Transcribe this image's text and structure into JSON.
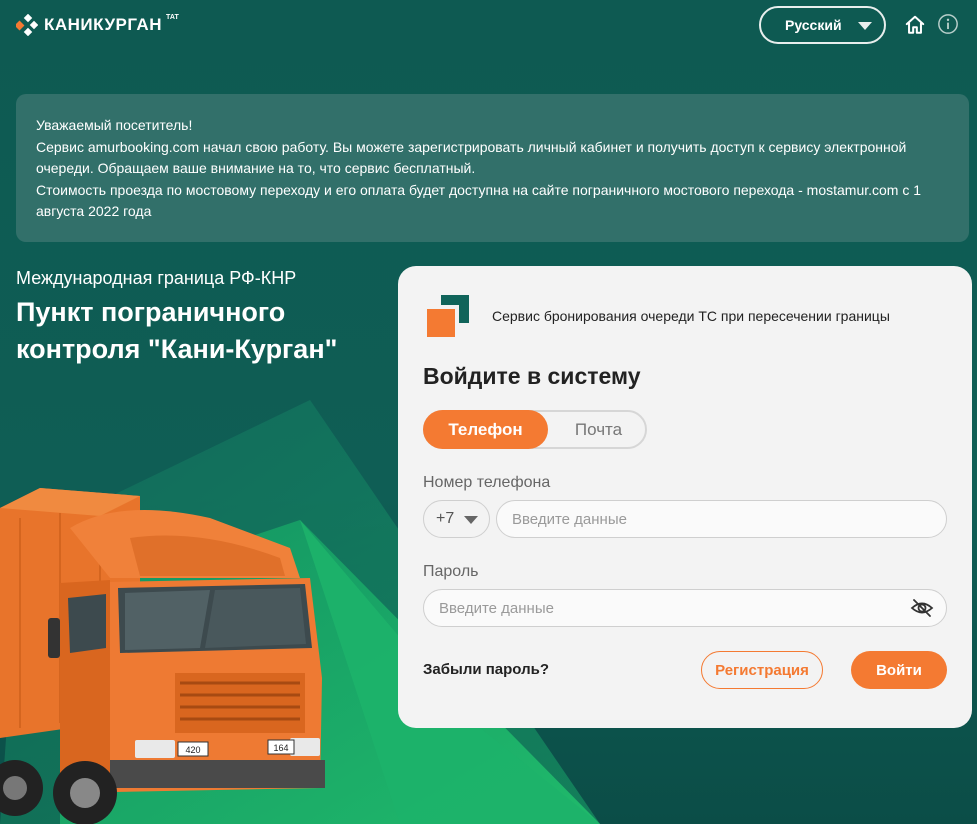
{
  "header": {
    "logo_text": "КАНИКУРГАН",
    "logo_suffix": "ТАТ",
    "language": "Русский"
  },
  "notice": {
    "lines": [
      "Уважаемый посетитель!",
      "Сервис amurbooking.com начал свою работу. Вы можете зарегистрировать личный кабинет и получить доступ к сервису электронной очереди. Обращаем ваше внимание на то, что сервис бесплатный.",
      "Стоимость проезда по мостовому переходу и его оплата будет доступна на сайте пограничного мостового перехода - mostamur.com с 1 августа 2022 года"
    ]
  },
  "hero": {
    "subtitle": "Международная граница РФ-КНР",
    "title": "Пункт пограничного контроля \"Кани-Курган\""
  },
  "truck": {
    "plate_left": "420",
    "plate_right": "164"
  },
  "login": {
    "service_text": "Сервис бронирования очереди ТС при пересечении границы",
    "heading": "Войдите в систему",
    "tab_phone": "Телефон",
    "tab_mail": "Почта",
    "phone_label": "Номер телефона",
    "phone_code": "+7",
    "phone_placeholder": "Введите данные",
    "password_label": "Пароль",
    "password_placeholder": "Введите данные",
    "forgot": "Забыли пароль?",
    "register": "Регистрация",
    "submit": "Войти"
  },
  "colors": {
    "accent": "#f47a32",
    "background": "#0f5a52",
    "card": "#f3f3f3"
  },
  "icons": [
    "logo-icon",
    "chevron-down-icon",
    "home-icon",
    "info-icon",
    "eye-off-icon"
  ]
}
